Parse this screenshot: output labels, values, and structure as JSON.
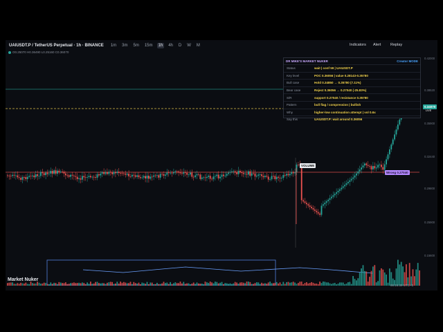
{
  "toolbar": {
    "symbol": "UAIUSDT.P / TetherUS Perpetual · 1h · BINANCE",
    "timeframes": [
      "1m",
      "3m",
      "5m",
      "15m",
      "1h",
      "4h",
      "D",
      "W",
      "M"
    ],
    "active_timeframe": "1h",
    "indicators_label": "Indicators",
    "alert_label": "Alert",
    "replay_label": "Replay"
  },
  "ohlc_text": "O0.25070 H0.36490 L0.25160 C0.36070",
  "panel": {
    "title": "DR MIKE'S MARKET NUKER",
    "mode": "Creator MODE",
    "rows": [
      {
        "key": "Status",
        "value": "wait | conf 59 | UAIUSDT.P"
      },
      {
        "key": "Key level",
        "value": "POC 0.36056 | value 0.28143-0.35780"
      },
      {
        "key": "Bull case",
        "value": "Hold 0.34850 → 0.35780 (7.11%)"
      },
      {
        "key": "Bear case",
        "value": "Reject 0.36056 → 0.27040 (-25.83%)"
      },
      {
        "key": "S/R",
        "value": "support 0.27040 / resistance 0.35780"
      },
      {
        "key": "Pattern",
        "value": "bull flag / compression | bullish"
      },
      {
        "key": "Why",
        "value": "higher-low continuation attempt | vol 0.6x"
      },
      {
        "key": "Say this",
        "value": "UAIUSDT.P: wait around 0.36056"
      }
    ]
  },
  "labels": {
    "volume": "VOLUME",
    "wrong": "Wrong 0.27040",
    "price_tag": "0.34070",
    "price_live": "LIVE",
    "indicator_title": "Market Nuker",
    "clock": "00:16:39 UTC+3"
  },
  "axis": {
    "ticks": [
      "0.42000",
      "0.38520",
      "0.35900",
      "0.32440",
      "0.29800",
      "0.25900",
      "0.15600"
    ]
  },
  "colors": {
    "up": "#26a69a",
    "down": "#ef5350",
    "accent": "#c9a9ff",
    "wrong": "#b388ff",
    "panel_value": "#f2d24c"
  }
}
